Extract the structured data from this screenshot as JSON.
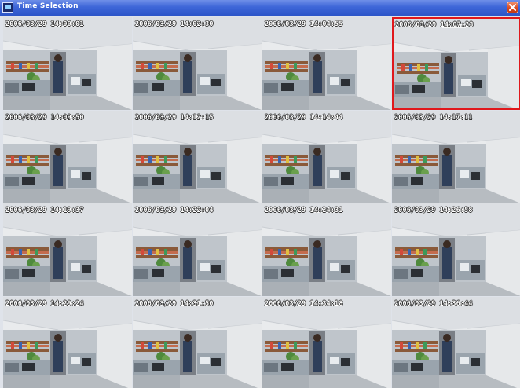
{
  "window": {
    "title": "Time Selection"
  },
  "thumbnails": [
    {
      "timestamp": "2006/03/29 14:00:01",
      "selected": false
    },
    {
      "timestamp": "2006/03/29 14:02:30",
      "selected": false
    },
    {
      "timestamp": "2006/03/29 14:04:55",
      "selected": false
    },
    {
      "timestamp": "2006/03/29 14:07:23",
      "selected": true
    },
    {
      "timestamp": "2006/03/29 14:09:50",
      "selected": false
    },
    {
      "timestamp": "2006/03/29 14:12:15",
      "selected": false
    },
    {
      "timestamp": "2006/03/29 14:14:44",
      "selected": false
    },
    {
      "timestamp": "2006/03/29 14:17:11",
      "selected": false
    },
    {
      "timestamp": "2006/03/29 14:19:37",
      "selected": false
    },
    {
      "timestamp": "2006/03/29 14:22:04",
      "selected": false
    },
    {
      "timestamp": "2006/03/29 14:24:31",
      "selected": false
    },
    {
      "timestamp": "2006/03/29 14:26:58",
      "selected": false
    },
    {
      "timestamp": "2006/03/29 14:29:24",
      "selected": false
    },
    {
      "timestamp": "2006/03/29 14:31:50",
      "selected": false
    },
    {
      "timestamp": "2006/03/29 14:34:18",
      "selected": false
    },
    {
      "timestamp": "2006/03/29 14:36:44",
      "selected": false
    }
  ],
  "colors": {
    "selection_border": "#e0181c",
    "titlebar": "#3e66d8"
  },
  "icons": {
    "app": "camera-app-icon",
    "close": "close-icon"
  }
}
